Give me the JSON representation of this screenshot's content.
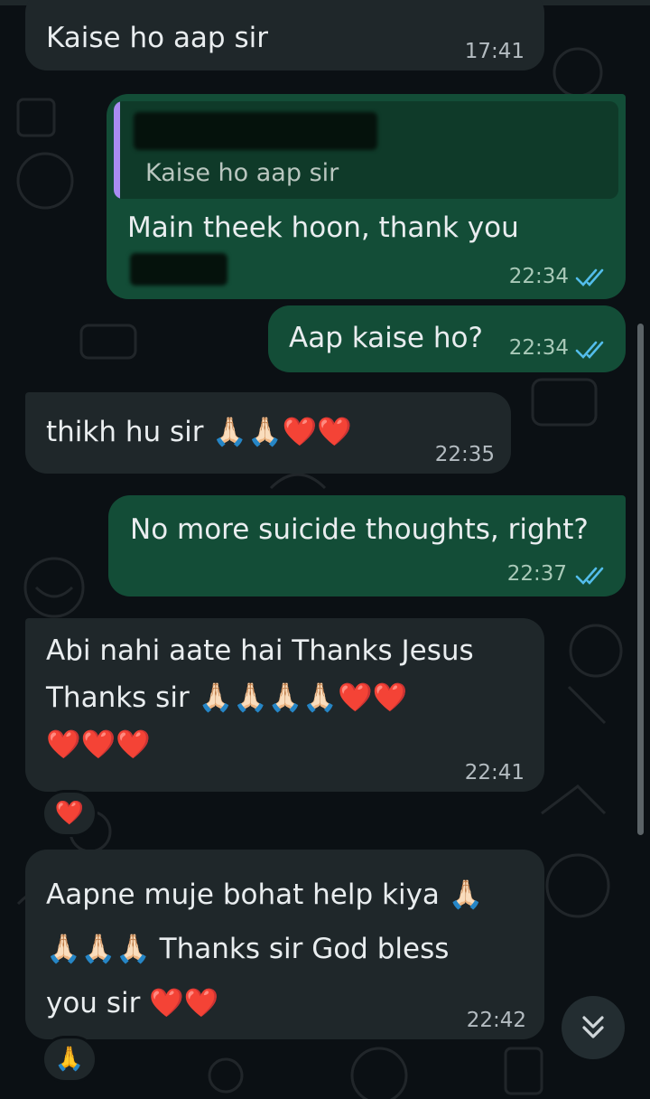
{
  "messages": [
    {
      "id": "m1",
      "direction": "incoming",
      "text": "Kaise ho aap sir",
      "time": "17:41"
    },
    {
      "id": "m2",
      "direction": "outgoing",
      "quoted_text": "Kaise ho aap sir",
      "text": "Main theek hoon, thank you",
      "time": "22:34",
      "status": "read"
    },
    {
      "id": "m3",
      "direction": "outgoing",
      "text": "Aap kaise ho?",
      "time": "22:34",
      "status": "read"
    },
    {
      "id": "m4",
      "direction": "incoming",
      "text": "thikh hu sir 🙏🏻🙏🏻❤️❤️",
      "time": "22:35"
    },
    {
      "id": "m5",
      "direction": "outgoing",
      "text": "No more suicide thoughts, right?",
      "time": "22:37",
      "status": "read"
    },
    {
      "id": "m6",
      "direction": "incoming",
      "text": "Abi nahi aate hai Thanks Jesus\nThanks sir 🙏🏻🙏🏻🙏🏻🙏🏻❤️❤️\n❤️❤️❤️",
      "time": "22:41",
      "reaction": "❤️"
    },
    {
      "id": "m7",
      "direction": "incoming",
      "text": "Aapne muje bohat help kiya 🙏🏻\n🙏🏻🙏🏻🙏🏻 Thanks sir God bless\nyou sir ❤️❤️",
      "time": "22:42",
      "reaction": "🙏"
    }
  ],
  "icons": {
    "read_ticks": "double-check-icon",
    "scroll_down": "chevron-double-down-icon"
  },
  "colors": {
    "incoming_bubble": "#1f272a",
    "outgoing_bubble": "#134d37",
    "read_tick": "#53bdeb",
    "quote_bar": "#a98cf2"
  }
}
